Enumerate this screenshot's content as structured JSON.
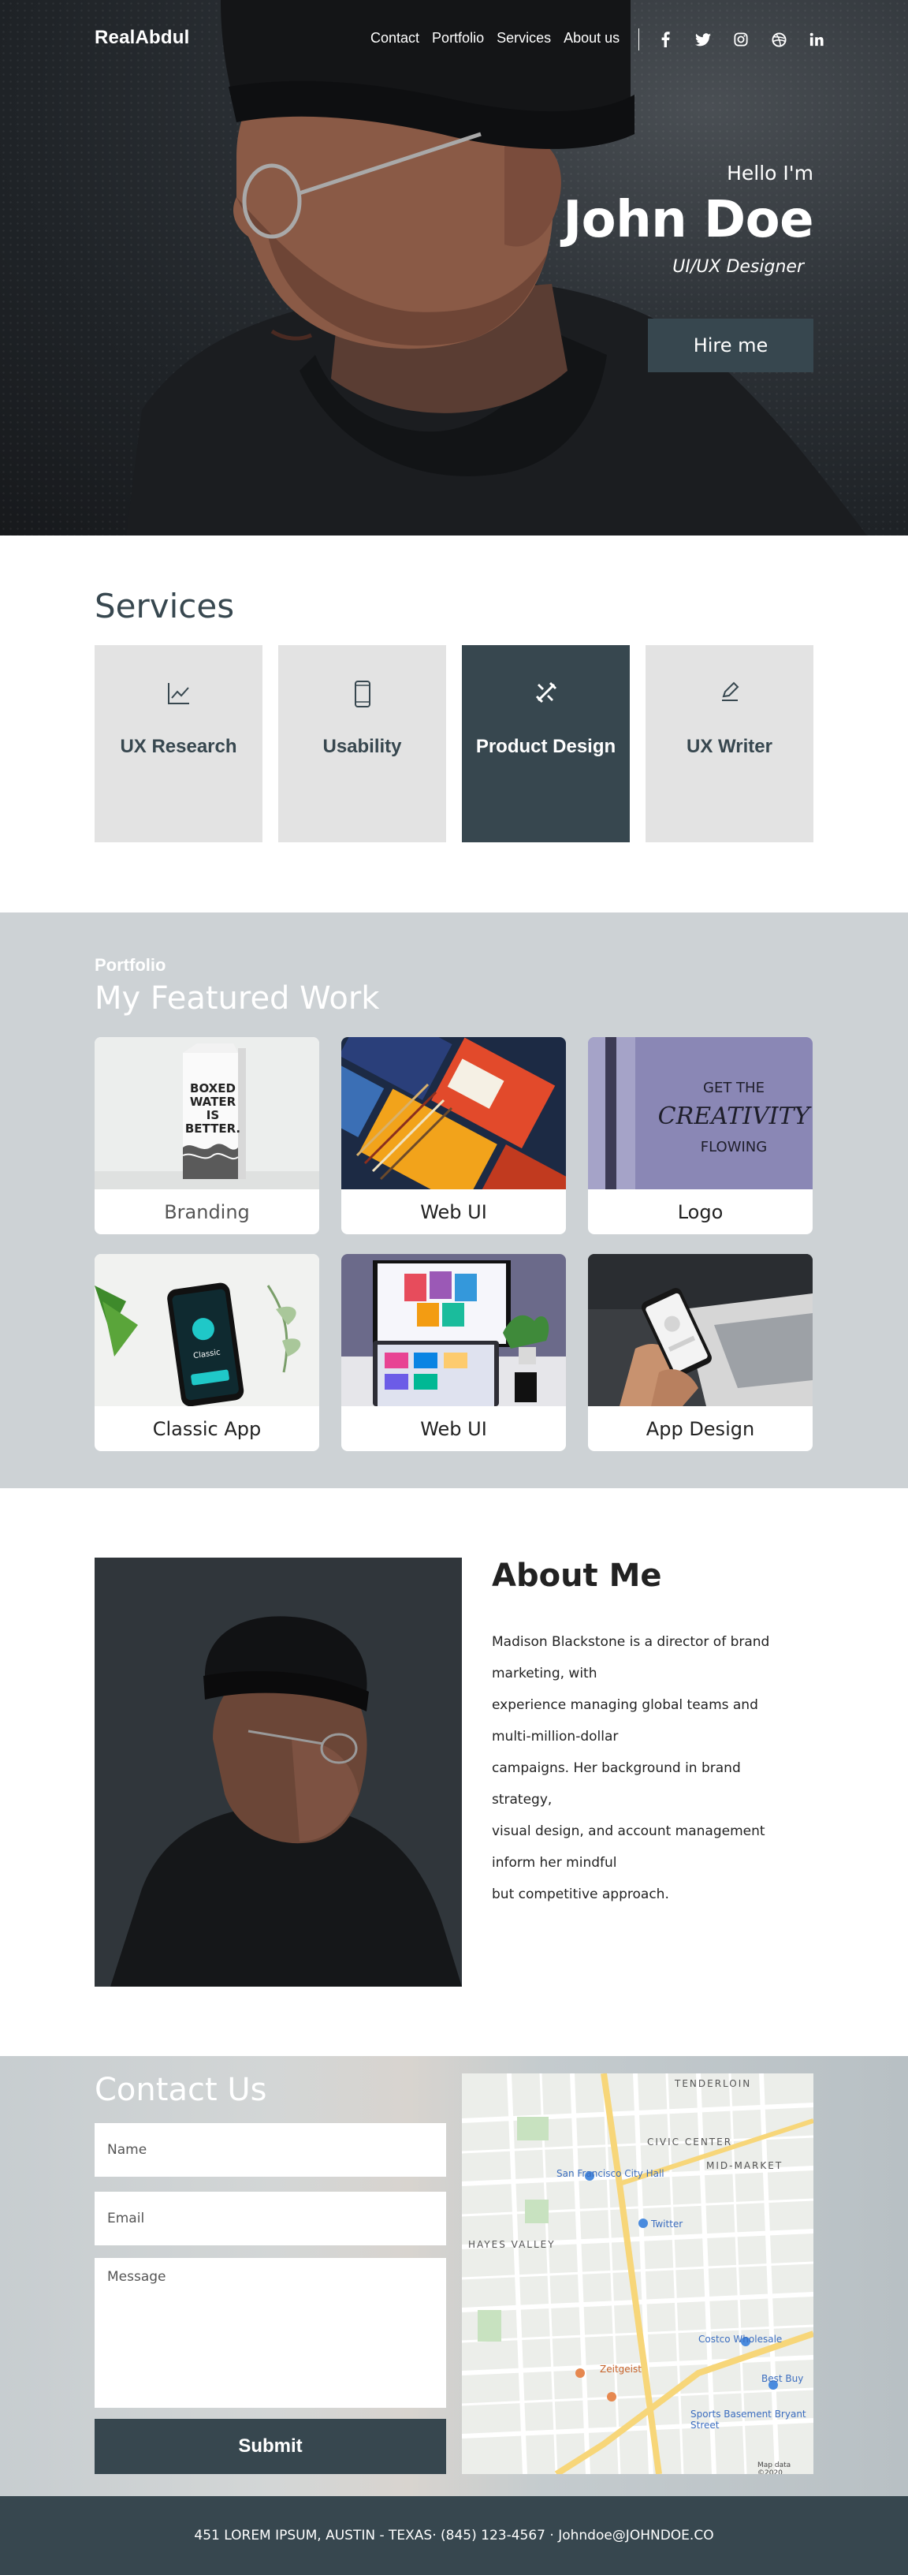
{
  "nav": {
    "logo": "RealAbdul",
    "links": [
      "Contact",
      "Portfolio",
      "Services",
      "About us"
    ],
    "social_icons": [
      "facebook-icon",
      "twitter-icon",
      "instagram-icon",
      "dribbble-icon",
      "linkedin-icon"
    ]
  },
  "hero": {
    "greeting": "Hello I'm",
    "name": "John Doe",
    "role": "UI/UX Designer",
    "cta": "Hire me"
  },
  "services": {
    "title": "Services",
    "items": [
      {
        "label": "UX Research",
        "icon": "chart-line-icon",
        "active": false
      },
      {
        "label": "Usability",
        "icon": "smartphone-icon",
        "active": false
      },
      {
        "label": "Product Design",
        "icon": "design-tools-icon",
        "active": true
      },
      {
        "label": "UX Writer",
        "icon": "pen-icon",
        "active": false
      }
    ]
  },
  "portfolio": {
    "eyebrow": "Portfolio",
    "title": "My Featured Work",
    "items": [
      {
        "label": "Branding",
        "thumb_text": [
          "BOXED",
          "WATER",
          "IS",
          "BETTER."
        ]
      },
      {
        "label": "Web UI"
      },
      {
        "label": "Logo",
        "thumb_text": [
          "GET THE",
          "CREATIVITY",
          "FLOWING"
        ]
      },
      {
        "label": "Classic App",
        "thumb_text": "Classic"
      },
      {
        "label": "Web UI"
      },
      {
        "label": "App Design"
      }
    ]
  },
  "about": {
    "title": "About Me",
    "lines": [
      "Madison Blackstone is a director of brand",
      "marketing, with",
      "experience managing global teams and",
      "multi-million-dollar",
      "campaigns. Her background in brand",
      "strategy,",
      "visual design, and account management",
      "inform her mindful",
      "but competitive approach."
    ]
  },
  "contact": {
    "title": "Contact Us",
    "name_placeholder": "Name",
    "email_placeholder": "Email",
    "message_placeholder": "Message",
    "submit": "Submit",
    "map_labels": {
      "hayes_valley": "HAYES VALLEY",
      "civic_center": "CIVIC CENTER",
      "mid_market": "MID-MARKET",
      "tenderloin": "TENDERLOIN",
      "city_hall": "San Francisco City Hall",
      "twitter": "Twitter",
      "costco": "Costco Wholesale",
      "best_buy": "Best Buy",
      "zeitgeist": "Zeitgeist",
      "sports_basement": "Sports Basement Bryant Street",
      "map_data": "Map data ©2020"
    }
  },
  "footer": {
    "text": "451 LOREM IPSUM, AUSTIN - TEXAS· (845) 123-4567 · Johndoe@JOHNDOE.CO"
  }
}
